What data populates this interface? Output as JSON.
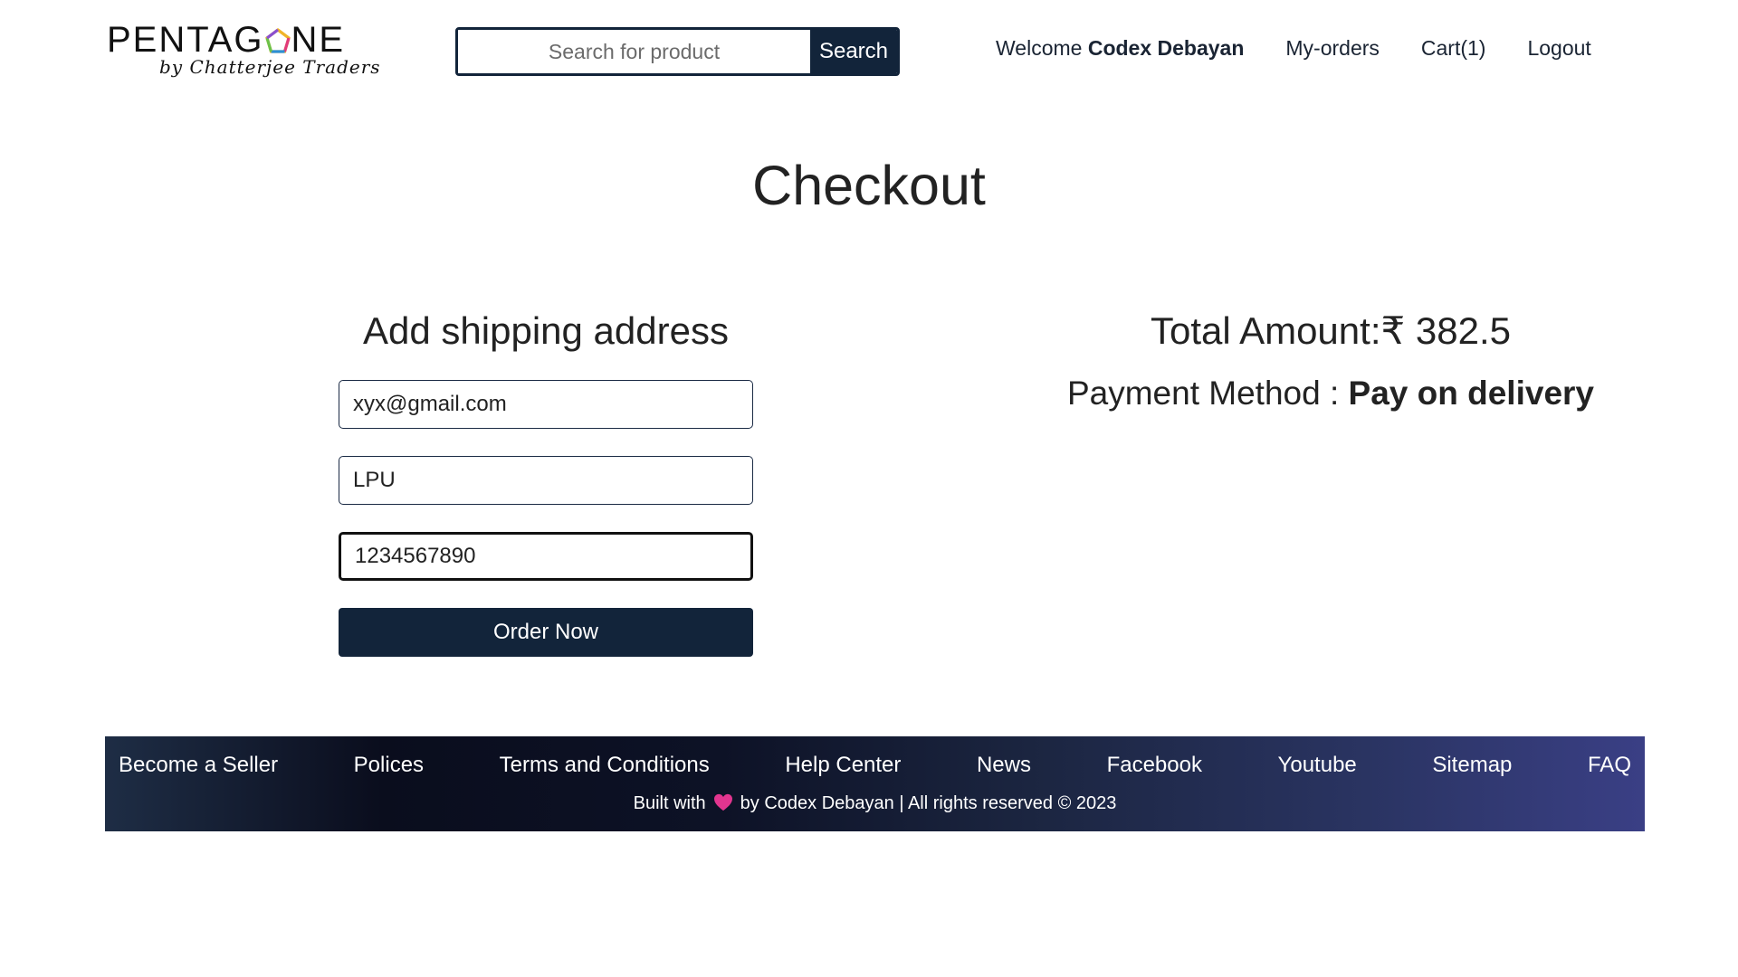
{
  "brand": {
    "name_prefix": "PENTAG",
    "name_suffix": "NE",
    "gem_icon": "pentagon-gem-icon",
    "tagline": "by Chatterjee Traders"
  },
  "search": {
    "placeholder": "Search for product",
    "value": "",
    "button_label": "Search"
  },
  "nav": {
    "welcome_prefix": "Welcome ",
    "user_name": "Codex Debayan",
    "my_orders": "My-orders",
    "cart": "Cart(1)",
    "logout": "Logout"
  },
  "page": {
    "title": "Checkout"
  },
  "shipping": {
    "heading": "Add shipping address",
    "email_value": "xyx@gmail.com",
    "address_value": "LPU",
    "phone_value": "1234567890",
    "submit_label": "Order Now"
  },
  "summary": {
    "total_label": "Total Amount:",
    "currency": "₹",
    "total_value": "382.5",
    "payment_label": "Payment Method : ",
    "payment_value": "Pay on delivery"
  },
  "footer": {
    "links": [
      "Become a Seller",
      "Polices",
      "Terms and Conditions",
      "Help Center",
      "News",
      "Facebook",
      "Youtube",
      "Sitemap",
      "FAQ"
    ],
    "credit_before": "Built with",
    "heart_icon": "heart-icon",
    "credit_after": "by Codex Debayan | All rights reserved © 2023"
  },
  "colors": {
    "primary_dark": "#12243a",
    "heart": "#e2358f",
    "footer_gradient_end": "#3a3f85"
  }
}
